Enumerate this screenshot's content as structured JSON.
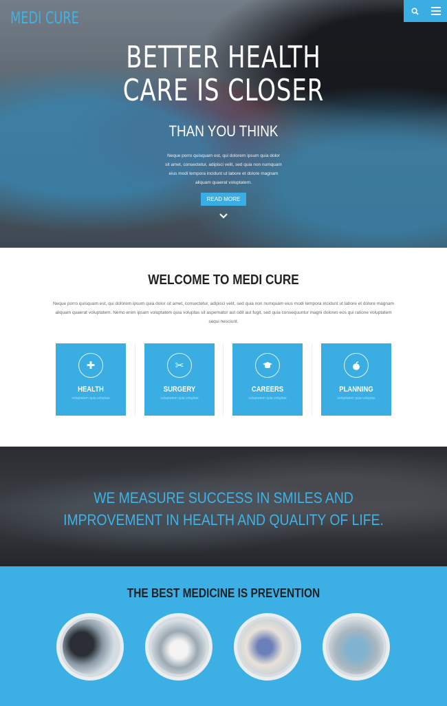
{
  "header": {
    "logo": "MEDI CURE",
    "search_icon": "search-icon",
    "menu_icon": "hamburger-menu-icon"
  },
  "hero": {
    "title_line1": "BETTER HEALTH",
    "title_line2": "CARE IS CLOSER",
    "subtitle": "THAN YOU THINK",
    "text": "Neque porro quisquam est, qui dolorem ipsum quia dolor sit amet, consectetur, adipisci velit, sed quia non numquam eius modi tempora incidunt ut labore et dolore magnam aliquam quaerat voluptatem.",
    "button_label": "READ MORE",
    "down_icon": "chevron-down-icon"
  },
  "welcome": {
    "title": "WELCOME TO MEDI CURE",
    "text": "Neque porro quisquam est, qui dolorem ipsum quia dolor sit amet, consectetur, adipisci velit, sed quia non numquam eius modi tempora incidunt ut labore et dolore magnam aliquam quaerat voluptatem. Nemo enim ipsam voluptatem quia voluptas sit aspernatur aut odit aut fugit, sed quia consequuntur magni dolores eos qui ratione voluptatem sequi nesciunt."
  },
  "cards": [
    {
      "title": "HEALTH",
      "subtitle": "voluptatem quia voluptas",
      "icon": "plus-icon",
      "glyph": "✚"
    },
    {
      "title": "SURGERY",
      "subtitle": "voluptatem quia voluptas",
      "icon": "scissors-icon",
      "glyph": "✂"
    },
    {
      "title": "CAREERS",
      "subtitle": "voluptatem quia voluptas",
      "icon": "graduation-cap-icon",
      "glyph": "🎓"
    },
    {
      "title": "PLANNING",
      "subtitle": "voluptatem quia voluptas",
      "icon": "apple-icon",
      "glyph": "●"
    }
  ],
  "quote": {
    "text": "WE MEASURE SUCCESS IN SMILES AND IMPROVEMENT IN HEALTH AND QUALITY OF LIFE."
  },
  "prevention": {
    "title": "THE BEST MEDICINE IS PREVENTION",
    "images": [
      "microscope-photo",
      "lab-worker-photo",
      "scientist-photo",
      "surgery-team-photo"
    ]
  },
  "colors": {
    "accent": "#3aaee2",
    "heading": "#222222"
  }
}
